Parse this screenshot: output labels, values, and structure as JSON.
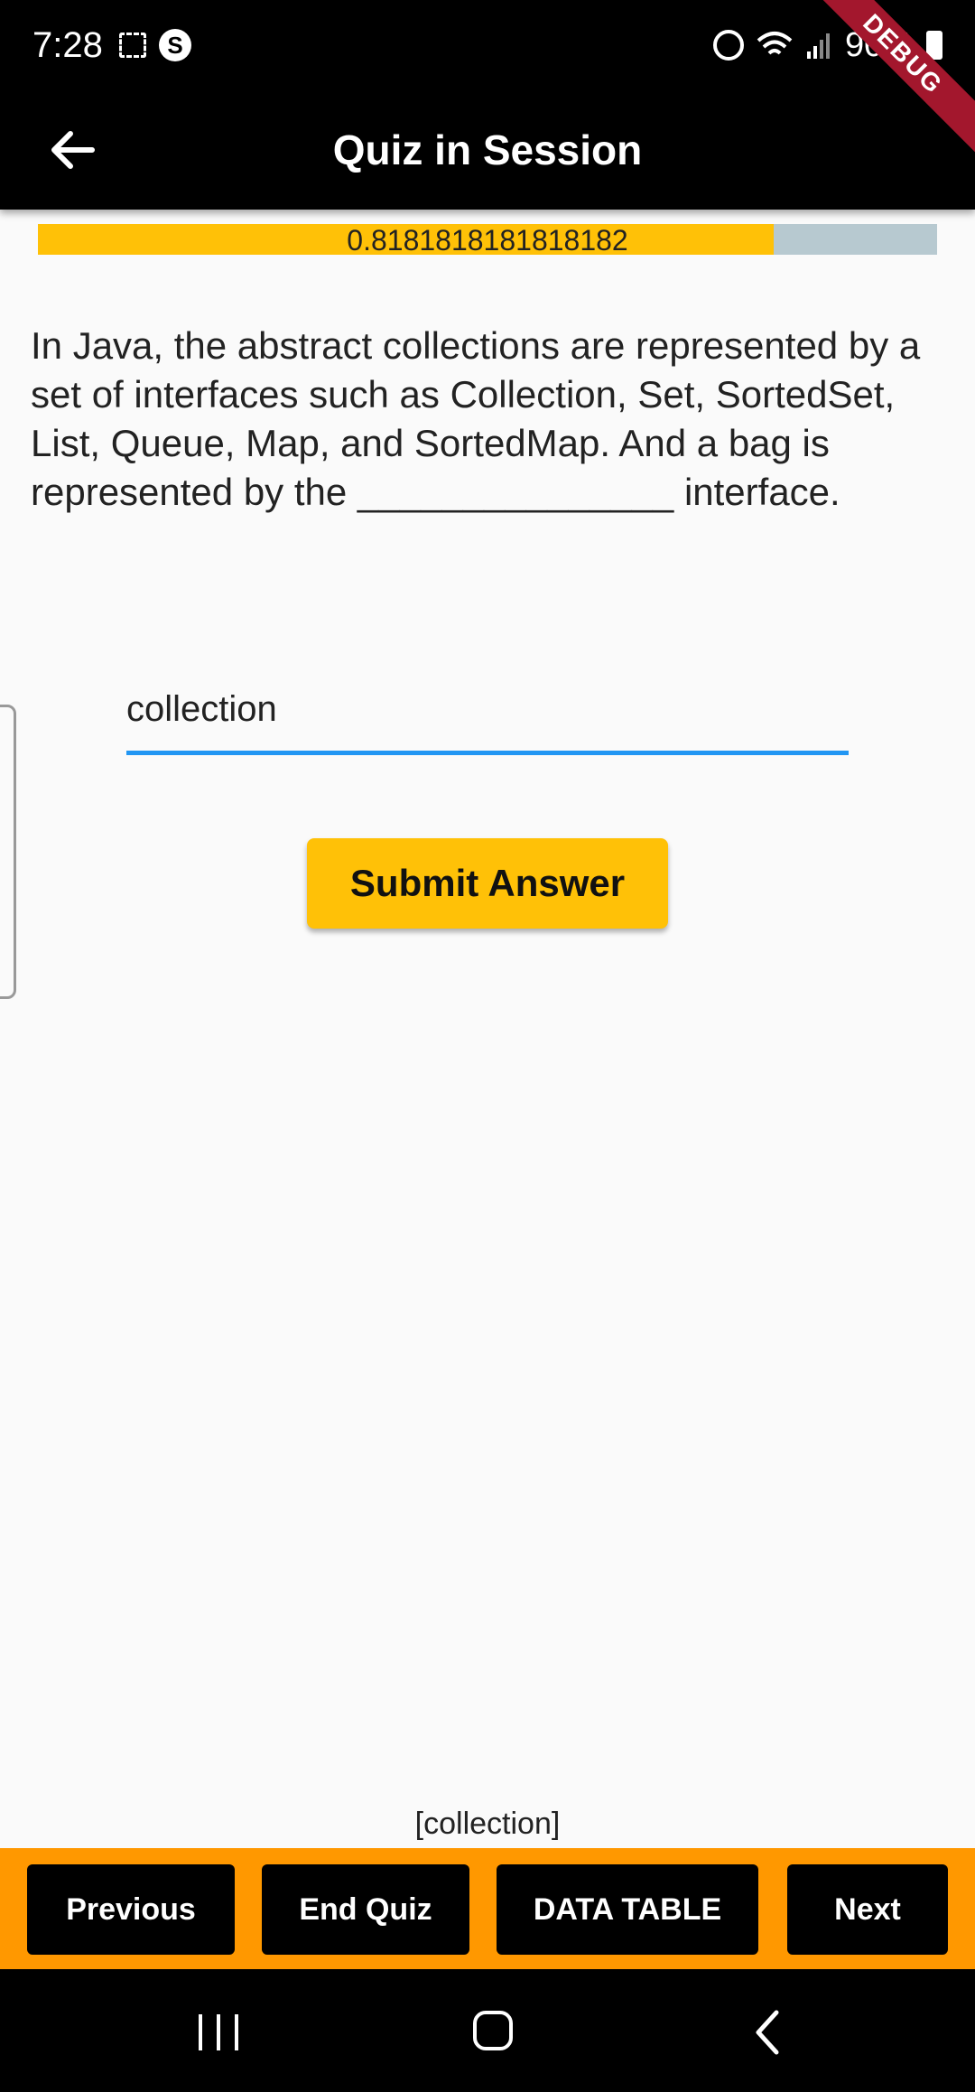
{
  "status_bar": {
    "time": "7:28",
    "battery": "90%",
    "debug_label": "DEBUG"
  },
  "app_bar": {
    "title": "Quiz in Session",
    "back_icon": "arrow-left-icon"
  },
  "progress": {
    "value_text": "0.8181818181818182",
    "fraction": 0.8181818181818182,
    "fill_color": "#ffc107",
    "track_color": "#b7c9d0"
  },
  "question": {
    "text": "In Java, the abstract collections are represented by a set of interfaces such as Collection, Set, SortedSet, List, Queue, Map, and SortedMap. And a bag is represented by the _______________ interface."
  },
  "answer_input": {
    "value": "collection"
  },
  "submit_button": {
    "label": "Submit Answer"
  },
  "submitted_answer": "[collection]",
  "actions": {
    "previous": "Previous",
    "end_quiz": "End Quiz",
    "data_table": "DATA TABLE",
    "next": "Next"
  },
  "colors": {
    "accent": "#ffc107",
    "action_bar": "#ff9800",
    "input_underline": "#2196f3"
  }
}
